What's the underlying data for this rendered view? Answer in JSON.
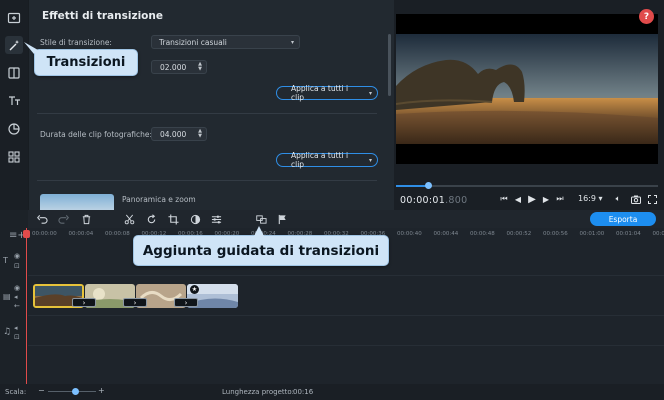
{
  "panel": {
    "title": "Effetti di transizione",
    "transition_style_label": "Stile di transizione:",
    "transition_style_value": "Transizioni casuali",
    "duration_value": "02.000",
    "apply_all_1": "Applica a tutti i clip",
    "photo_duration_label": "Durata delle clip fotografiche:",
    "photo_duration_value": "04.000",
    "apply_all_2": "Applica a tutti i clip",
    "pan_zoom_label": "Panoramica e zoom"
  },
  "rail": {
    "items": [
      {
        "name": "import",
        "icon": "import-icon"
      },
      {
        "name": "transitions",
        "icon": "magic-wand-icon"
      },
      {
        "name": "filters",
        "icon": "filters-icon"
      },
      {
        "name": "titles",
        "icon": "titles-icon"
      },
      {
        "name": "stickers",
        "icon": "stickers-icon"
      },
      {
        "name": "more",
        "icon": "grid-icon"
      }
    ]
  },
  "preview": {
    "help": "?",
    "timecode_main": "00:00:01",
    "timecode_frac": ".800",
    "aspect_ratio": "16:9 ▾",
    "progress_fraction": 0.12
  },
  "toolbar": {
    "export_label": "Esporta"
  },
  "ruler": {
    "ticks": [
      "00:00:00",
      "00:00:04",
      "00:00:08",
      "00:00:12",
      "00:00:16",
      "00:00:20",
      "00:00:24",
      "00:00:28",
      "00:00:32",
      "00:00:36",
      "00:00:40",
      "00:00:44",
      "00:00:48",
      "00:00:52",
      "00:00:56",
      "00:01:00",
      "00:01:04",
      "00:01:08"
    ]
  },
  "status": {
    "scale_label": "Scala:",
    "project_length_label": "Lunghezza progetto:",
    "project_length_value": "00:16"
  },
  "callouts": {
    "transitions": "Transizioni",
    "guided_transitions": "Aggiunta guidata di transizioni"
  },
  "colors": {
    "accent": "#1d8ef0",
    "playhead": "#e04b4b",
    "callout_bg": "#cfe4f7"
  }
}
